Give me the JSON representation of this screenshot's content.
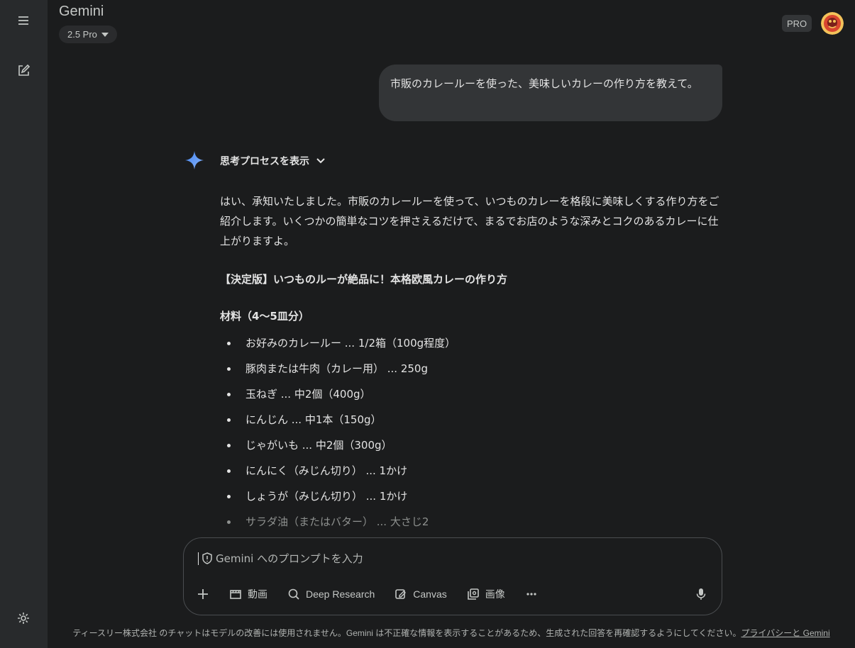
{
  "app": {
    "title": "Gemini",
    "model": "2.5 Pro",
    "plan_badge": "PRO"
  },
  "icons": {
    "menu": "menu-icon",
    "new_chat": "edit-icon",
    "settings": "gear-icon",
    "spark": "gemini-spark-icon",
    "avatar": "user-avatar"
  },
  "colors": {
    "background": "#1b1c1d",
    "sidebar": "#282a2c",
    "bubble": "#333537",
    "spark_start": "#4285f4",
    "spark_end": "#8ab4f8"
  },
  "user_message": "市販のカレールーを使った、美味しいカレーの作り方を教えて。",
  "response": {
    "thinking_toggle": "思考プロセスを表示",
    "intro": "はい、承知いたしました。市販のカレールーを使って、いつものカレーを格段に美味しくする作り方をご紹介します。いくつかの簡単なコツを押さえるだけで、まるでお店のような深みとコクのあるカレーに仕上がりますよ。",
    "heading": "【決定版】いつものルーが絶品に！本格欧風カレーの作り方",
    "ingredients_heading": "材料（4〜5皿分）",
    "ingredients": [
      "お好みのカレールー ... 1/2箱（100g程度）",
      "豚肉または牛肉（カレー用） ... 250g",
      "玉ねぎ ... 中2個（400g）",
      "にんじん ... 中1本（150g）",
      "じゃがいも ... 中2個（300g）",
      "にんにく（みじん切り） ... 1かけ",
      "しょうが（みじん切り） ... 1かけ",
      "サラダ油（またはバター） ... 大さじ2"
    ]
  },
  "input": {
    "placeholder": "Gemini へのプロンプトを入力",
    "tools": {
      "video": "動画",
      "deep_research": "Deep Research",
      "canvas": "Canvas",
      "image": "画像"
    }
  },
  "footer": {
    "text": "ティースリー株式会社 のチャットはモデルの改善には使用されません。Gemini は不正確な情報を表示することがあるため、生成された回答を再確認するようにしてください。",
    "link": "プライバシーと Gemini"
  }
}
